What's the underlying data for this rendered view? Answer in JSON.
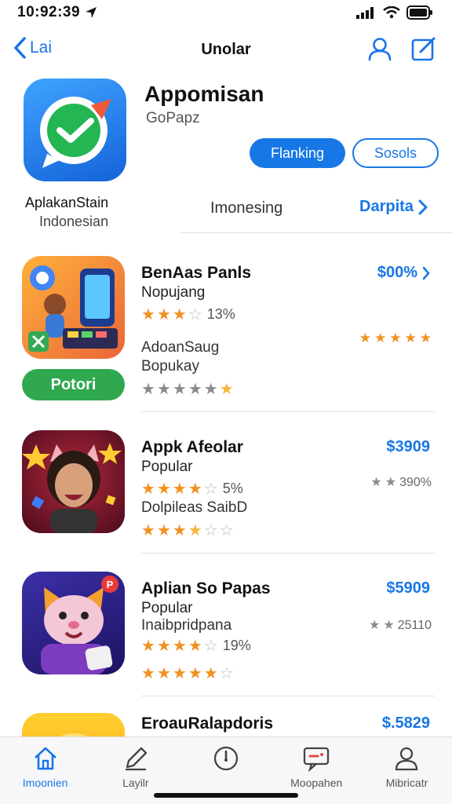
{
  "status": {
    "time": "10:92:39"
  },
  "nav": {
    "back_label": "Lai",
    "title": "Unolar"
  },
  "hero": {
    "title": "Appomisan",
    "subtitle": "GoPapz",
    "primary_button": "Flanking",
    "secondary_button": "Sosols",
    "name": "AplakanStain",
    "location": "Indonesian",
    "tab_label": "Imonesing",
    "link_label": "Darpita"
  },
  "apps": [
    {
      "title": "BenAas Panls",
      "subtitle": "Nopujang",
      "price": "$00%",
      "rating": 3,
      "rating_text": "13%",
      "second_title": "AdoanSaug",
      "second_subtitle": "Bopukay",
      "install_button": "Potori"
    },
    {
      "title": "Appk Afeolar",
      "subtitle": "Popular",
      "price": "$3909",
      "rating": 4,
      "rating_text": "5%",
      "second_title": "Dolpileas SaibD",
      "right_rating_text": "390%"
    },
    {
      "title": "Aplian So Papas",
      "subtitle": "Popular",
      "price": "$5909",
      "second_title": "Inaibpridpana",
      "rating": 4,
      "rating_text": "19%",
      "right_rating_text": "25110"
    },
    {
      "title": "EroauRalapdoris",
      "price": "$.5829"
    }
  ],
  "tabs": [
    {
      "label": "Imoonien",
      "icon": "home-icon"
    },
    {
      "label": "Layilr",
      "icon": "pen-icon"
    },
    {
      "label": "",
      "icon": "compass-icon"
    },
    {
      "label": "Moopahen",
      "icon": "chat-icon"
    },
    {
      "label": "Mibricatr",
      "icon": "profile-icon"
    }
  ],
  "colors": {
    "accent": "#1877e6",
    "install": "#2fa84f",
    "star": "#f19020"
  }
}
